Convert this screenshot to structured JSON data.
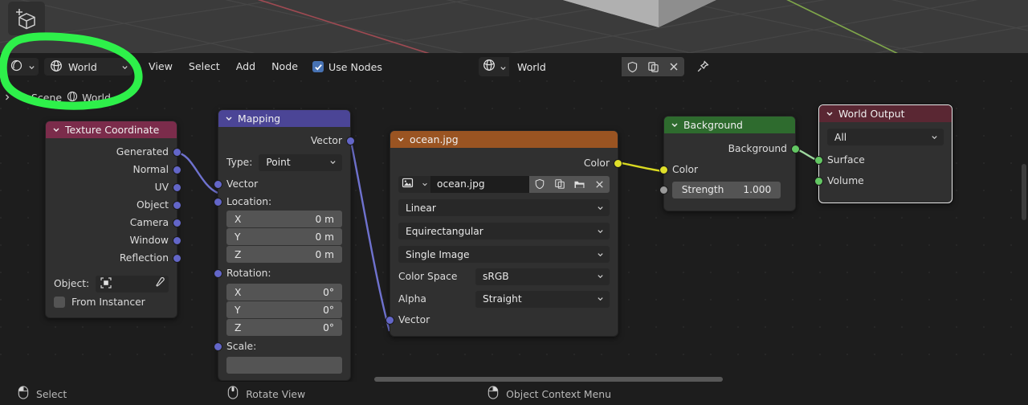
{
  "viewport": {
    "add_cube_icon": "add-cube-icon",
    "grid_color": "#4a4a4a",
    "axis_x_color": "#9e4a52",
    "axis_y_color": "#7fa64a",
    "background": "#3b3b3b"
  },
  "header": {
    "editor_type_icon": "shading-sphere-icon",
    "shader_type_icon": "world-globe-icon",
    "shader_type_label": "World",
    "menus": [
      "View",
      "Select",
      "Add",
      "Node"
    ],
    "use_nodes_label": "Use Nodes",
    "use_nodes_checked": true,
    "use_nodes_accent": "#4772b3",
    "datablock": {
      "icon": "world-globe-icon",
      "name": "World",
      "fake_user_icon": "shield-icon",
      "new_icon": "copy-icon",
      "unlink_icon": "close-x-icon",
      "pin_icon": "pin-icon"
    }
  },
  "breadcrumb": {
    "arrow_icon": "chevron-right-icon",
    "items": [
      {
        "icon": "scene-icon",
        "label": "Scene"
      },
      {
        "icon": "world-globe-icon",
        "label": "World"
      }
    ]
  },
  "annotation": {
    "color": "#2ef04a",
    "shape": "circle-scribble-around-shader-type-selector"
  },
  "nodes": [
    {
      "id": "texture-coordinate",
      "title": "Texture Coordinate",
      "header_color": "#7b2c4b",
      "collapse_icon": "chevron-down-icon",
      "outputs": [
        "Generated",
        "Normal",
        "UV",
        "Object",
        "Camera",
        "Window",
        "Reflection"
      ],
      "object_label": "Object:",
      "object_value": "",
      "object_icon": "object-placeholder-icon",
      "eyedropper_icon": "eyedropper-icon",
      "from_instancer_label": "From Instancer",
      "from_instancer_checked": false
    },
    {
      "id": "mapping",
      "title": "Mapping",
      "header_color": "#4b4596",
      "collapse_icon": "chevron-down-icon",
      "output_label": "Vector",
      "type_label": "Type:",
      "type_value": "Point",
      "vector_input_label": "Vector",
      "location_label": "Location:",
      "location": [
        {
          "axis": "X",
          "value": "0 m"
        },
        {
          "axis": "Y",
          "value": "0 m"
        },
        {
          "axis": "Z",
          "value": "0 m"
        }
      ],
      "rotation_label": "Rotation:",
      "rotation": [
        {
          "axis": "X",
          "value": "0°"
        },
        {
          "axis": "Y",
          "value": "0°"
        },
        {
          "axis": "Z",
          "value": "0°"
        }
      ],
      "scale_label": "Scale:"
    },
    {
      "id": "environment-texture",
      "title": "ocean.jpg",
      "header_color": "#9a5422",
      "collapse_icon": "chevron-down-icon",
      "output_label": "Color",
      "image_icon": "image-datablock-icon",
      "image_name": "ocean.jpg",
      "fake_user_icon": "shield-icon",
      "new_icon": "copy-icon",
      "open_icon": "folder-icon",
      "unlink_icon": "close-x-icon",
      "interpolation": "Linear",
      "projection": "Equirectangular",
      "image_source": "Single Image",
      "color_space_label": "Color Space",
      "color_space_value": "sRGB",
      "alpha_label": "Alpha",
      "alpha_value": "Straight",
      "vector_input_label": "Vector"
    },
    {
      "id": "background",
      "title": "Background",
      "header_color": "#2e6b2e",
      "collapse_icon": "chevron-down-icon",
      "output_label": "Background",
      "color_input_label": "Color",
      "strength_label": "Strength",
      "strength_value": "1.000"
    },
    {
      "id": "world-output",
      "title": "World Output",
      "header_color": "#5a2733",
      "collapse_icon": "chevron-down-icon",
      "selected": true,
      "target_value": "All",
      "inputs": [
        "Surface",
        "Volume"
      ]
    }
  ],
  "links": [
    {
      "from": "Texture Coordinate.Generated",
      "to": "Mapping.Vector",
      "color": "#6f72cf"
    },
    {
      "from": "Mapping.Vector",
      "to": "ocean.jpg.Vector",
      "color": "#6f72cf"
    },
    {
      "from": "ocean.jpg.Color",
      "to": "Background.Color",
      "color": "#d9d921"
    },
    {
      "from": "Background.Background",
      "to": "World Output.Surface",
      "color": "#9fd9a0"
    }
  ],
  "statusbar": {
    "items": [
      {
        "icon": "mouse-left-button-icon",
        "label": "Select"
      },
      {
        "icon": "mouse-middle-button-icon",
        "label": "Rotate View"
      },
      {
        "icon": "mouse-right-button-icon",
        "label": "Object Context Menu"
      }
    ]
  }
}
